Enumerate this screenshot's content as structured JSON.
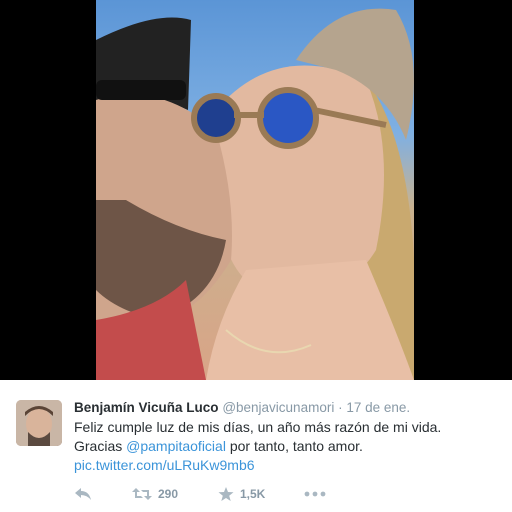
{
  "tweet": {
    "author_name": "Benjamín Vicuña Luco",
    "handle": "@benjavicunamori",
    "separator": "·",
    "date": "17 de ene.",
    "text_line1": "Feliz cumple luz de mis días, un año más razón de mi vida.",
    "text_line2_prefix": "Gracias ",
    "mention": "@pampitaoficial",
    "text_line2_suffix": " por tanto, tanto amor.",
    "media_link": "pic.twitter.com/uLRuKw9mb6"
  },
  "actions": {
    "reply_icon": "reply-icon",
    "retweet_icon": "retweet-icon",
    "retweet_count": "290",
    "favorite_icon": "star-icon",
    "favorite_count": "1,5K",
    "more_icon": "more-icon"
  },
  "colors": {
    "text": "#292f33",
    "muted": "#8899a6",
    "link": "#3b94d9",
    "icon": "#aab8c2"
  }
}
